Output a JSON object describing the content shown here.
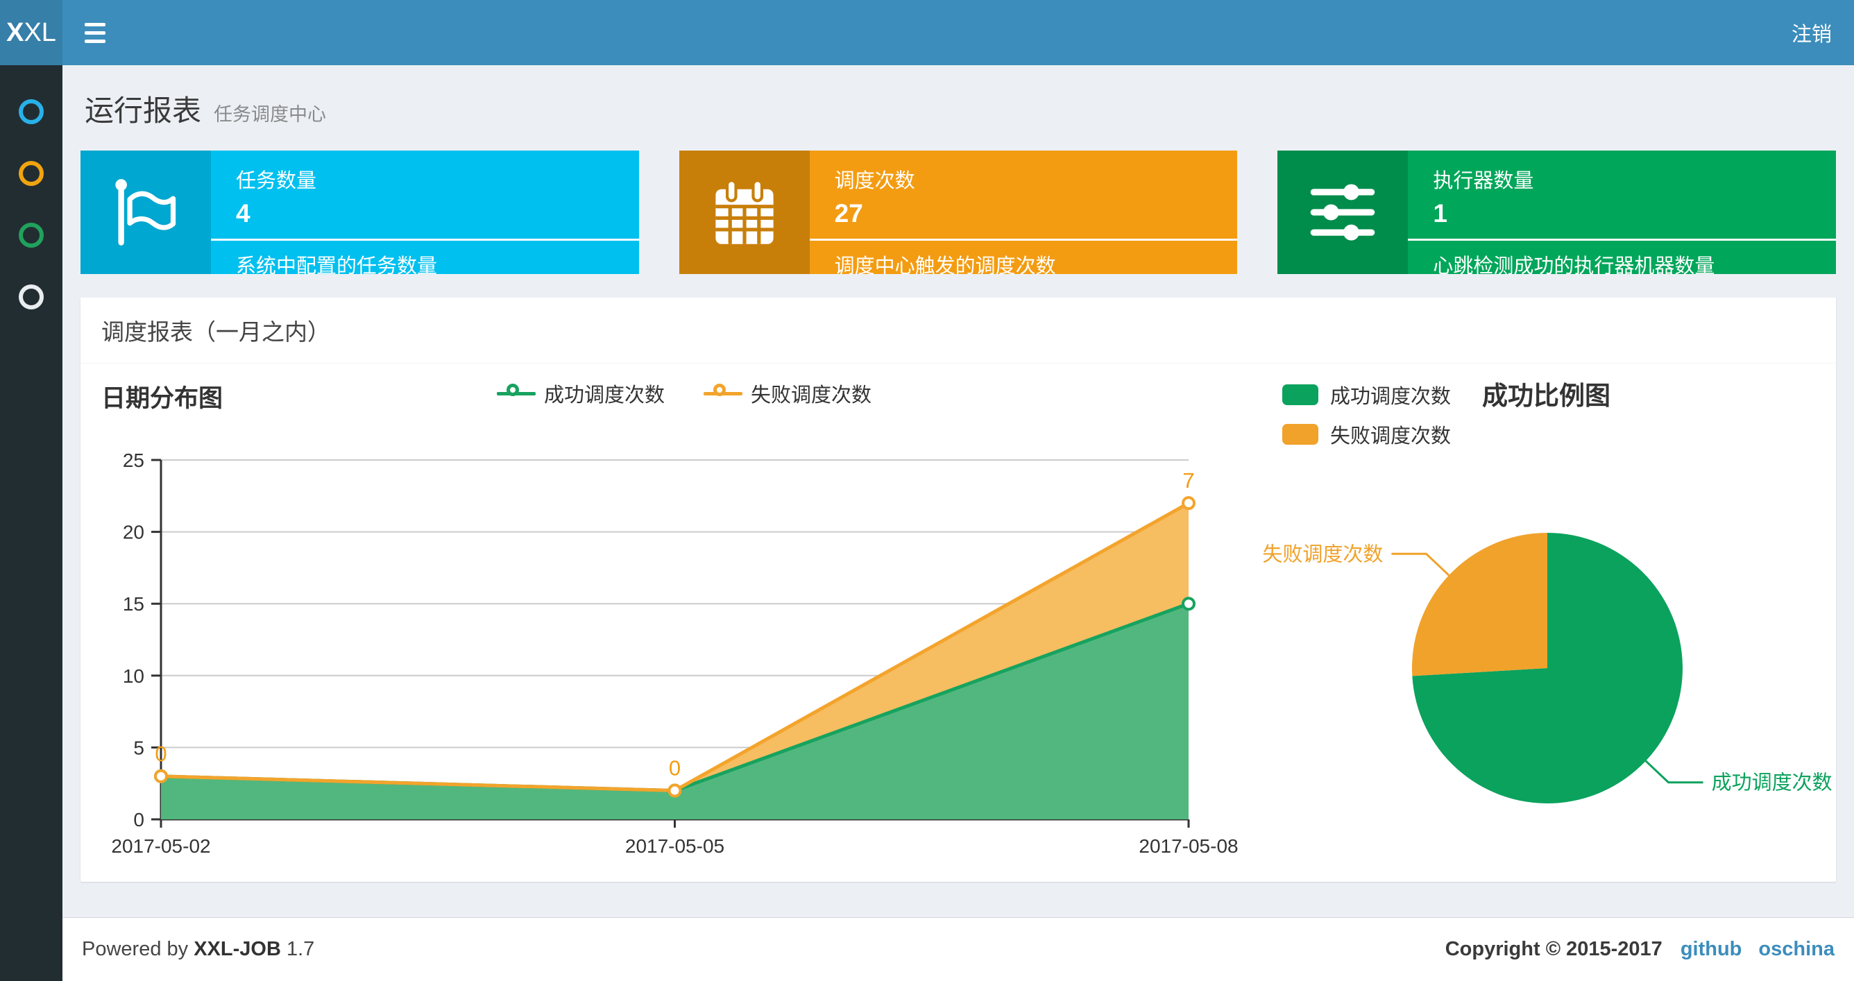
{
  "header": {
    "logo_bold": "X",
    "logo_rest": "XL",
    "logout_label": "注销"
  },
  "sidebar": {
    "items": [
      {
        "id": "item-1",
        "icon": "circle-icon",
        "color": "#29b1e8"
      },
      {
        "id": "item-2",
        "icon": "circle-icon",
        "color": "#f0a40e"
      },
      {
        "id": "item-3",
        "icon": "circle-icon",
        "color": "#20a25c"
      },
      {
        "id": "item-4",
        "icon": "circle-icon",
        "color": "#e9edef"
      }
    ]
  },
  "page": {
    "title": "运行报表",
    "subtitle": "任务调度中心"
  },
  "stat_cards": [
    {
      "icon": "flag-icon",
      "label": "任务数量",
      "value": "4",
      "desc": "系统中配置的任务数量",
      "bg": "#00c0ef",
      "icon_bg": "#00a7d0"
    },
    {
      "icon": "calendar-icon",
      "label": "调度次数",
      "value": "27",
      "desc": "调度中心触发的调度次数",
      "bg": "#f39c12",
      "icon_bg": "#c87f0a"
    },
    {
      "icon": "sliders-icon",
      "label": "执行器数量",
      "value": "1",
      "desc": "心跳检测成功的执行器机器数量",
      "bg": "#00a65a",
      "icon_bg": "#008d4c"
    }
  ],
  "panel": {
    "title": "调度报表（一月之内）"
  },
  "chart_data": [
    {
      "type": "area",
      "title": "日期分布图",
      "x": [
        "2017-05-02",
        "2017-05-05",
        "2017-05-08"
      ],
      "series": [
        {
          "name": "成功调度次数",
          "values": [
            3,
            2,
            15
          ],
          "stack": true,
          "color": "#00a65a",
          "line_color": "#17a35f",
          "area_color": "#52b77e"
        },
        {
          "name": "失败调度次数",
          "values": [
            0,
            0,
            7
          ],
          "stack": true,
          "color": "#f39c12",
          "line_color": "#f3a42c",
          "area_color": "#f6bd61",
          "point_labels": [
            "0",
            "0",
            "7"
          ],
          "label_color": "#f39c12"
        }
      ],
      "ylim": [
        0,
        25
      ],
      "yticks": [
        0,
        5,
        10,
        15,
        20,
        25
      ],
      "grid": true,
      "legend_position": "top"
    },
    {
      "type": "pie",
      "title": "成功比例图",
      "slices": [
        {
          "name": "成功调度次数",
          "value": 20,
          "color": "#0ba25d"
        },
        {
          "name": "失败调度次数",
          "value": 7,
          "color": "#f0a22b"
        }
      ],
      "start_angle": "top",
      "direction": "clockwise",
      "legend_position": "top-left"
    }
  ],
  "footer": {
    "powered_prefix": "Powered by",
    "product": "XXL-JOB",
    "version": "1.7",
    "copyright": "Copyright © 2015-2017",
    "links": [
      {
        "label": "github"
      },
      {
        "label": "oschina"
      }
    ]
  }
}
